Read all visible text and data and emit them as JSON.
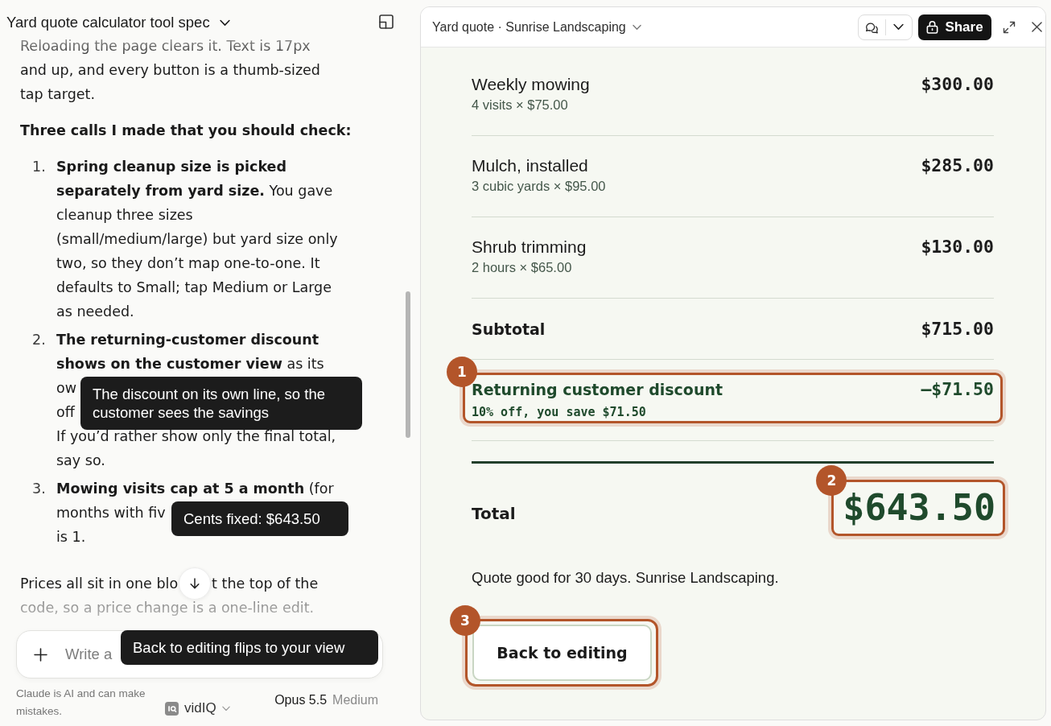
{
  "chat": {
    "title": "Yard quote calculator tool spec",
    "intro": "Reloading the page clears it. Text is 17px and up, and every button is a thumb-sized tap target.",
    "heading": "Three calls I made that you should check:",
    "calls": [
      {
        "number": "1.",
        "fragments": [
          "**Spring cleanup size is picked separately from yard size.** You gave cleanup three sizes (small/medium/large) but yard size only two, so they don’t map one-to-one. It defaults to Small; tap Medium or Large as needed."
        ]
      },
      {
        "number": "2.",
        "fragments": [
          "**The returning-customer discount shows on the customer view** as its",
          "ow",
          "off",
          "If you’d rather show only the final total, say so."
        ],
        "tooltip": "The discount on its own line, so the customer sees the savings"
      },
      {
        "number": "3.",
        "fragments": [
          "**Mowing visits cap at 5 a month** (for",
          "months with fiv",
          "is 1."
        ],
        "tooltip": "Cents fixed: $643.50"
      }
    ],
    "closing": [
      "Prices all sit in one blo",
      "t the top of the",
      "code, so a price change is a one-line edit."
    ]
  },
  "composer": {
    "placeholder": "Write a",
    "tooltip": "Back to editing flips to your view"
  },
  "footer": {
    "disclaimer": "Claude is AI and can make mistakes.",
    "connector": "vidIQ",
    "model": "Opus 5.5",
    "effort": "Medium"
  },
  "preview": {
    "title": "Yard quote · Sunrise Landscaping",
    "share": "Share",
    "lines": [
      {
        "kind": "item",
        "label": "Weekly mowing",
        "detail": "4 visits × $75.00",
        "amount": "$300.00"
      },
      {
        "kind": "item",
        "label": "Mulch, installed",
        "detail": "3 cubic yards × $95.00",
        "amount": "$285.00"
      },
      {
        "kind": "item",
        "label": "Shrub trimming",
        "detail": "2 hours × $65.00",
        "amount": "$130.00"
      },
      {
        "kind": "subtotal",
        "label": "Subtotal",
        "amount": "$715.00"
      },
      {
        "kind": "discount",
        "label": "Returning customer discount",
        "detail": "10% off, you save $71.50",
        "amount": "–$71.50",
        "callout": "1"
      }
    ],
    "total": {
      "label": "Total",
      "amount": "$643.50",
      "callout": "2"
    },
    "note": "Quote good for 30 days. Sunrise Landscaping.",
    "back_button": {
      "label": "Back to editing",
      "callout": "3"
    }
  }
}
